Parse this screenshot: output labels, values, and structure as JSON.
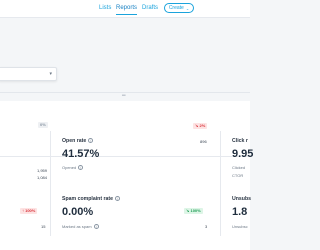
{
  "nav": {
    "lists": "Lists",
    "reports": "Reports",
    "drafts": "Drafts",
    "create": "Create"
  },
  "dropdown": {
    "caret": "▾"
  },
  "stats": {
    "left_top": {
      "badge": "0%",
      "row1_value": "1,959",
      "row2_value": "1,084"
    },
    "left_bottom": {
      "badge": "↑ 100%",
      "value": "15"
    },
    "open_rate": {
      "label": "Open rate",
      "value": "41.57%",
      "badge": "↘ 2%",
      "sub_label": "Opened",
      "sub_value": "896"
    },
    "spam_rate": {
      "label": "Spam complaint rate",
      "value": "0.00%",
      "badge": "↘ 100%",
      "sub_label": "Marked as spam",
      "sub_value": "3"
    },
    "click_rate": {
      "label": "Click r",
      "value": "9.95",
      "sub_label1": "Clicked",
      "sub_label2": "CTOR"
    },
    "unsub_rate": {
      "label": "Unsubs",
      "value": "1.8",
      "sub_label": "Unsubsc"
    }
  },
  "colors": {
    "accent": "#1aa3dc",
    "negative": "#d9363e",
    "positive": "#1f9d55"
  }
}
